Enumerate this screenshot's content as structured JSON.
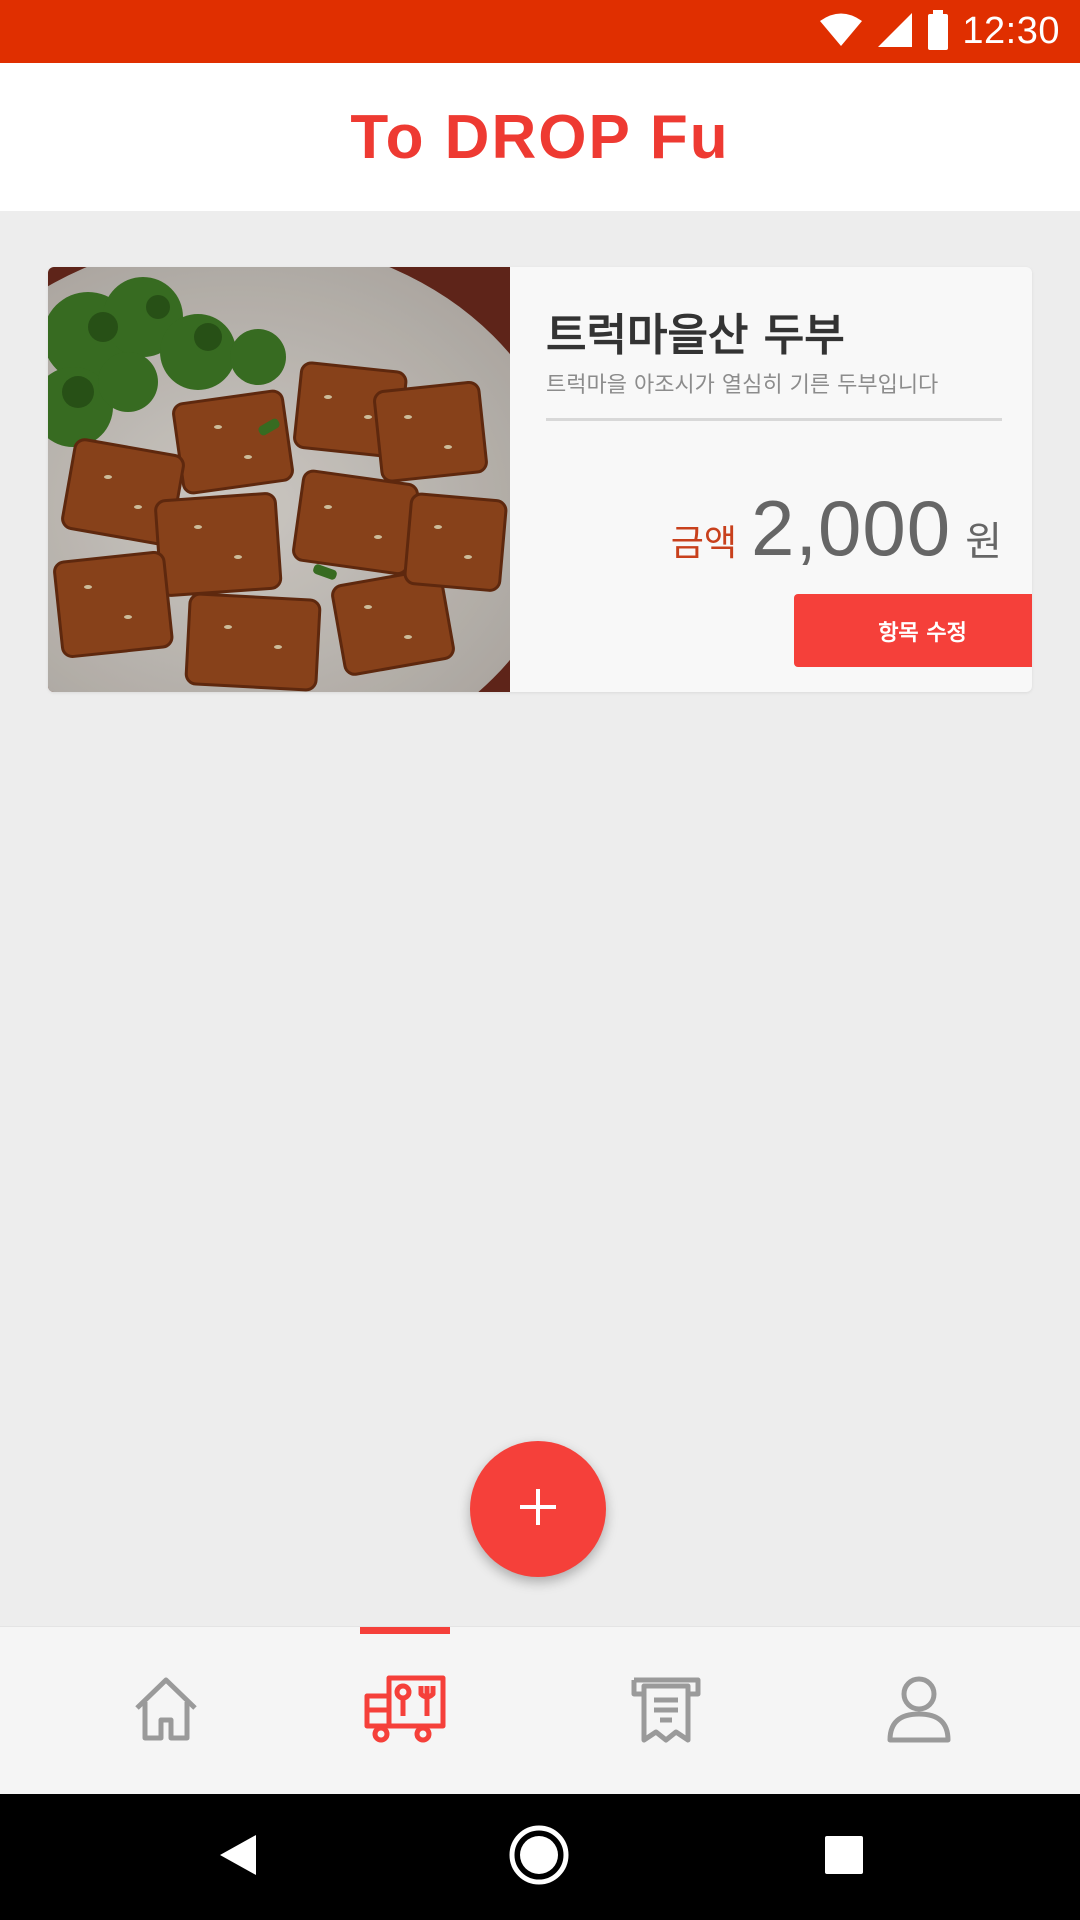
{
  "status_bar": {
    "time": "12:30",
    "background": "#e02f00",
    "icons": [
      "wifi-icon",
      "signal-icon",
      "battery-icon"
    ]
  },
  "header": {
    "title": "To DROP Fu",
    "title_color": "#ee3a32"
  },
  "items": [
    {
      "name": "트럭마을산 두부",
      "description": "트럭마을 아조시가 열심히 기른 두부입니다",
      "price_label": "금액",
      "price": "2,000",
      "price_unit": "원",
      "edit_label": "항목 수정",
      "image": "fried-tofu-with-broccoli"
    }
  ],
  "fab": {
    "icon": "plus-icon",
    "color": "#f5403a"
  },
  "bottom_nav": {
    "items": [
      {
        "icon": "home-icon",
        "active": false
      },
      {
        "icon": "food-truck-icon",
        "active": true
      },
      {
        "icon": "receipt-icon",
        "active": false
      },
      {
        "icon": "profile-icon",
        "active": false
      }
    ],
    "active_color": "#f5403a",
    "inactive_color": "#9a9a9a"
  },
  "system_nav": {
    "icons": [
      "back-icon",
      "home-circle-icon",
      "recents-icon"
    ]
  }
}
